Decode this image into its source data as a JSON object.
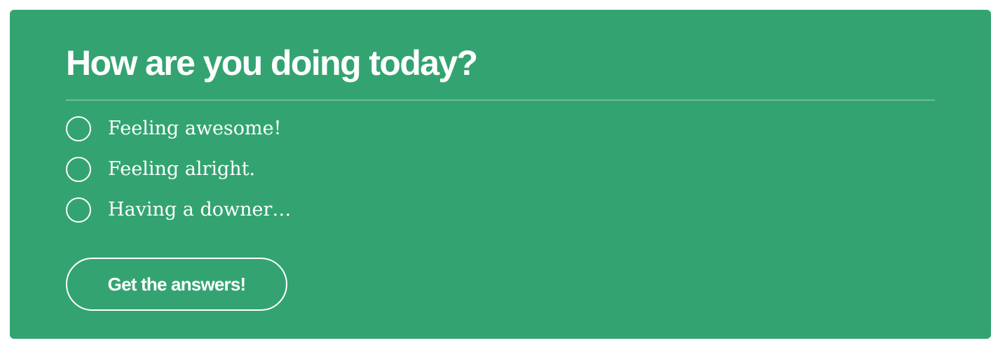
{
  "poll": {
    "question": "How are you doing today?",
    "options": [
      {
        "label": "Feeling awesome!"
      },
      {
        "label": "Feeling alright."
      },
      {
        "label": "Having a downer…"
      }
    ],
    "submit_label": "Get the answers!"
  },
  "colors": {
    "card_background": "#33a471",
    "text": "#ffffff",
    "page_background": "#ffffff"
  }
}
